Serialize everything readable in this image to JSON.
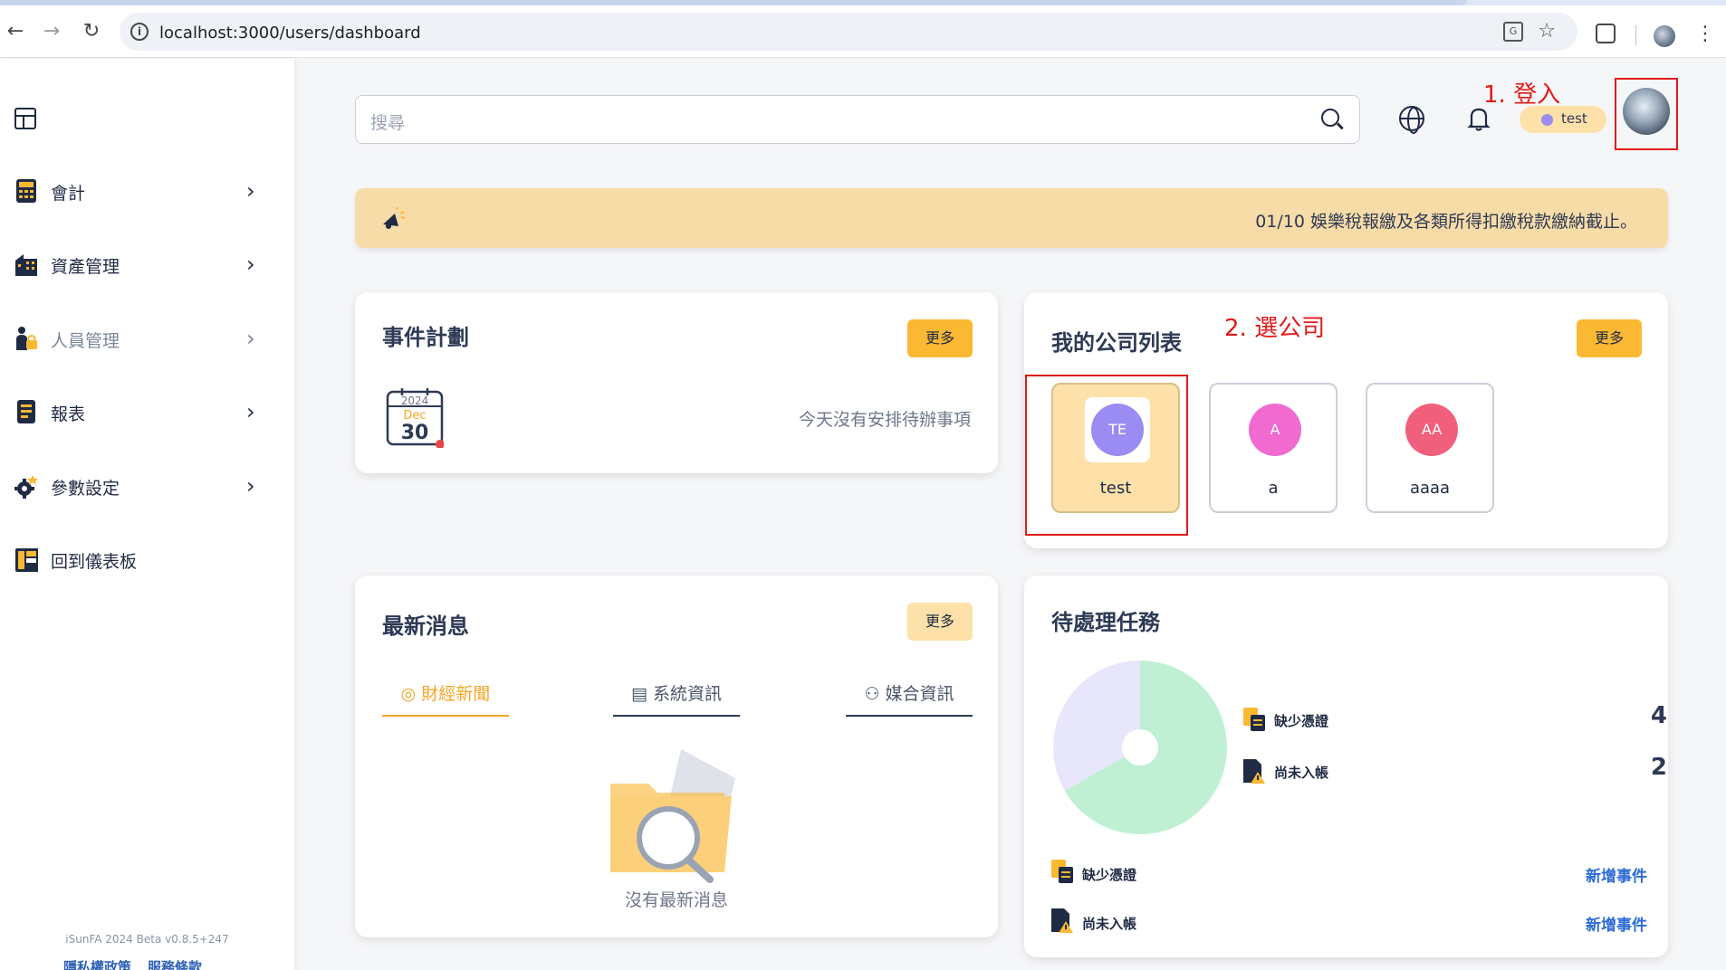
{
  "browser": {
    "url": "localhost:3000/users/dashboard"
  },
  "sidebar": {
    "items": [
      {
        "label": "會計",
        "icon": "calculator-icon"
      },
      {
        "label": "資產管理",
        "icon": "building-icon"
      },
      {
        "label": "人員管理",
        "icon": "person-lock-icon"
      },
      {
        "label": "報表",
        "icon": "report-icon"
      },
      {
        "label": "參數設定",
        "icon": "settings-icon"
      },
      {
        "label": "回到儀表板",
        "icon": "dashboard-icon"
      }
    ],
    "version": "iSunFA 2024 Beta v0.8.5+247",
    "links": [
      "隱私權政策",
      "服務條款"
    ]
  },
  "header": {
    "search_placeholder": "搜尋",
    "user_name": "test"
  },
  "annotations": {
    "login": "1. 登入",
    "select_company": "2. 選公司"
  },
  "banner": {
    "message": "01/10 娛樂稅報繳及各類所得扣繳稅款繳納截止。"
  },
  "events": {
    "title": "事件計劃",
    "more": "更多",
    "calendar": {
      "year": "2024",
      "month": "Dec",
      "day": "30"
    },
    "empty": "今天沒有安排待辦事項"
  },
  "companies": {
    "title": "我的公司列表",
    "more": "更多",
    "items": [
      {
        "initials": "TE",
        "name": "test",
        "color": "#9a8cf2"
      },
      {
        "initials": "A",
        "name": "a",
        "color": "#f06ad0"
      },
      {
        "initials": "AA",
        "name": "aaaa",
        "color": "#f0607c"
      }
    ]
  },
  "news": {
    "title": "最新消息",
    "more": "更多",
    "tabs": [
      "財經新聞",
      "系統資訊",
      "媒合資訊"
    ],
    "empty": "沒有最新消息"
  },
  "tasks": {
    "title": "待處理任務",
    "legend": [
      {
        "label": "缺少憑證",
        "value": "4"
      },
      {
        "label": "尚未入帳",
        "value": "2"
      }
    ],
    "rows": [
      {
        "label": "缺少憑證",
        "action": "新增事件"
      },
      {
        "label": "尚未入帳",
        "action": "新增事件"
      }
    ]
  },
  "chart_data": {
    "type": "pie",
    "categories": [
      "缺少憑證",
      "尚未入帳"
    ],
    "values": [
      4,
      2
    ],
    "colors": [
      "#bff0d4",
      "#e8e6fa"
    ],
    "style": "donut"
  }
}
